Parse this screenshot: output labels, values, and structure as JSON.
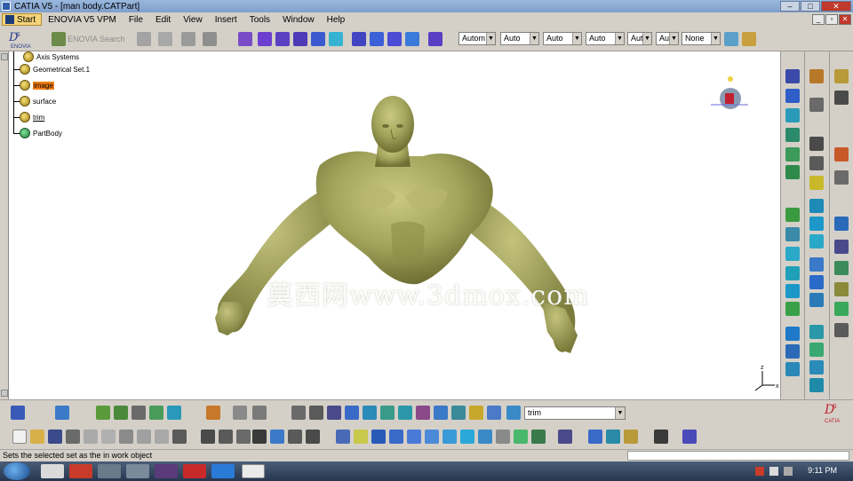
{
  "window": {
    "title": "CATIA V5 - [man body.CATPart]"
  },
  "menu": {
    "start": "Start",
    "items": [
      "ENOVIA V5 VPM",
      "File",
      "Edit",
      "View",
      "Insert",
      "Tools",
      "Window",
      "Help"
    ]
  },
  "toolbar": {
    "enovia_search": "ENOVIA Search",
    "combos": [
      "Autom",
      "Auto",
      "Auto",
      "Auto",
      "Aut",
      "Aut",
      "None"
    ]
  },
  "tree": {
    "items": [
      {
        "label": "Axis Systems"
      },
      {
        "label": "Geometrical Set.1"
      },
      {
        "label": "image",
        "highlight": true
      },
      {
        "label": "surface"
      },
      {
        "label": "trim",
        "underline": true
      },
      {
        "label": "PartBody"
      }
    ]
  },
  "watermark": "莫西网www.3dmox.com",
  "current_object": "trim",
  "status_text": "Sets the selected set as the in work object",
  "taskbar": {
    "time": "9:11 PM"
  },
  "colors": {
    "model": "#a7a860",
    "highlight": "#f07d14",
    "start_button": "#f4d37a"
  }
}
